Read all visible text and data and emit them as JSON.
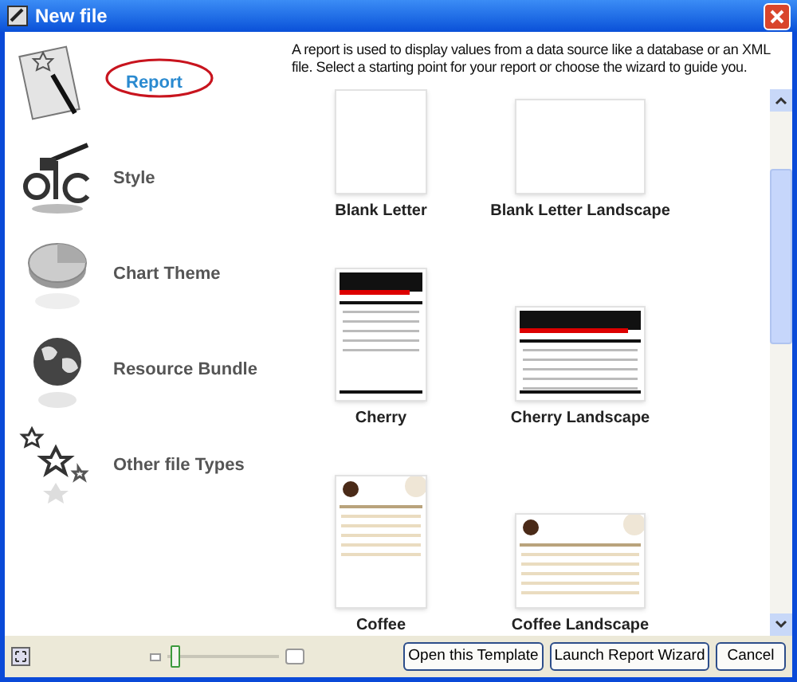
{
  "window": {
    "title": "New file"
  },
  "sidebar": {
    "items": [
      {
        "label": "Report",
        "kind": "wand",
        "selected": true
      },
      {
        "label": "Style",
        "kind": "abc",
        "selected": false
      },
      {
        "label": "Chart Theme",
        "kind": "pie",
        "selected": false
      },
      {
        "label": "Resource Bundle",
        "kind": "globe",
        "selected": false
      },
      {
        "label": "Other file Types",
        "kind": "stars",
        "selected": false
      }
    ]
  },
  "description": "A report is used to display values from a data source like a database or an XML file. Select a starting point for your report or choose the wizard to guide you.",
  "templates": [
    {
      "label": "Blank Letter",
      "landscape": false,
      "kind": "blank"
    },
    {
      "label": "Blank Letter Landscape",
      "landscape": true,
      "kind": "blank"
    },
    {
      "label": "Cherry",
      "landscape": false,
      "kind": "cherry"
    },
    {
      "label": "Cherry Landscape",
      "landscape": true,
      "kind": "cherry"
    },
    {
      "label": "Coffee",
      "landscape": false,
      "kind": "coffee"
    },
    {
      "label": "Coffee Landscape",
      "landscape": true,
      "kind": "coffee"
    }
  ],
  "zoom": {
    "level": 0.05
  },
  "buttons": [
    "Open this Template",
    "Launch Report Wizard",
    "Cancel"
  ]
}
